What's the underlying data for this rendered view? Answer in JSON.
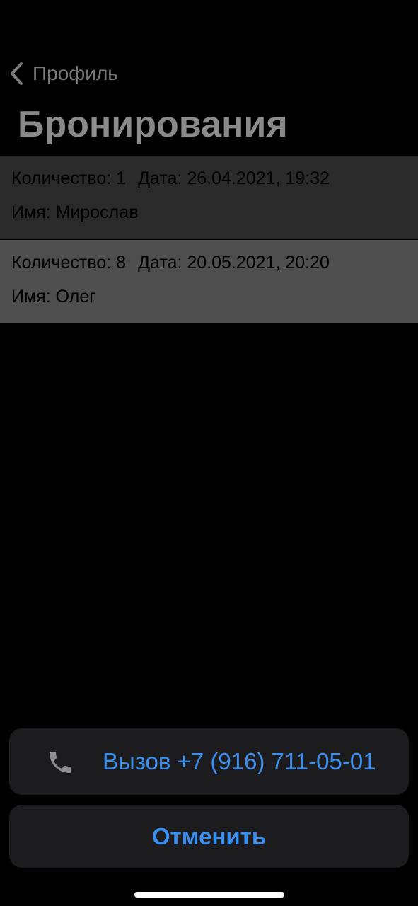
{
  "nav": {
    "back_label": "Профиль",
    "back_icon": "chevron-left-icon"
  },
  "header": {
    "title": "Бронирования"
  },
  "bookings": [
    {
      "quantity_label": "Количество: 1",
      "date_label": "Дата: 26.04.2021, 19:32",
      "name_label": "Имя: Мирослав"
    },
    {
      "quantity_label": "Количество: 8",
      "date_label": "Дата: 20.05.2021, 20:20",
      "name_label": "Имя: Олег"
    }
  ],
  "action_sheet": {
    "call_label": "Вызов +7 (916) 711-05-01",
    "call_icon": "phone-icon",
    "cancel_label": "Отменить"
  },
  "colors": {
    "background": "#000000",
    "accent": "#3b8fef",
    "sheet_button": "#1c1c1e",
    "row_dimmed": "#2a2a2a",
    "row_selected": "#4e4e4e",
    "title_text": "#8a8a8a"
  }
}
